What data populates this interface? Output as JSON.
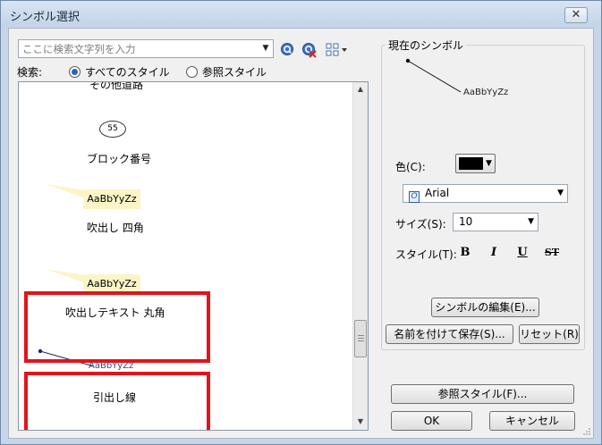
{
  "window": {
    "title": "シンボル選択",
    "close_glyph": "✕"
  },
  "search": {
    "placeholder": "ここに検索文字列を入力",
    "label": "検索:",
    "options": [
      {
        "label": "すべてのスタイル",
        "checked": true
      },
      {
        "label": "参照スタイル",
        "checked": false
      }
    ]
  },
  "symbol_list": {
    "items": [
      {
        "label": "その他道路"
      },
      {
        "label": "ブロック番号",
        "preview_text": "55"
      },
      {
        "label": "吹出し 四角",
        "preview_text": "AaBbYyZz"
      },
      {
        "label": "吹出しテキスト 丸角",
        "preview_text": "AaBbYyZz"
      },
      {
        "label": "引出し線",
        "preview_text": "AaBbYyZz"
      }
    ]
  },
  "current_symbol": {
    "group_title": "現在のシンボル",
    "preview_text": "AaBbYyZz"
  },
  "properties": {
    "color_label": "色(C):",
    "color_value": "#000000",
    "font_value": "Arial",
    "size_label": "サイズ(S):",
    "size_value": "10",
    "style_label": "スタイル(T):",
    "style_buttons": [
      "B",
      "I",
      "U",
      "ST"
    ]
  },
  "buttons": {
    "edit_symbol": "シンボルの編集(E)...",
    "save_as": "名前を付けて保存(S)...",
    "reset": "リセット(R)",
    "reference_styles": "参照スタイル(F)...",
    "ok": "OK",
    "cancel": "キャンセル"
  },
  "colors": {
    "highlight": "#e2141c",
    "callout_fill": "#fbf5c6",
    "leader_text": "#2a4f87"
  }
}
